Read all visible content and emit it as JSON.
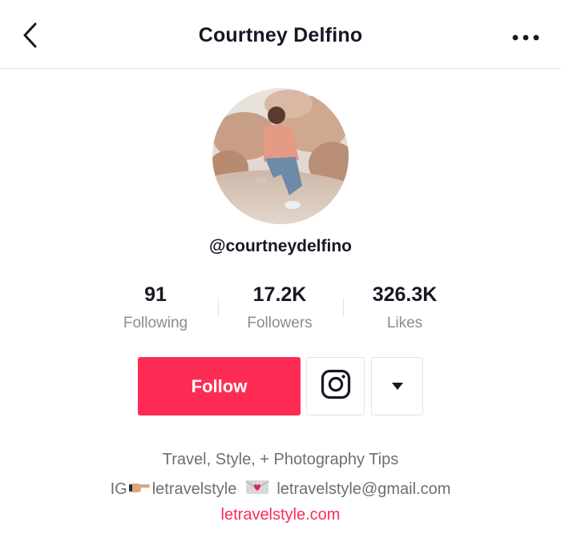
{
  "header": {
    "title": "Courtney Delfino",
    "back_icon": "back-arrow-icon",
    "more_icon": "more-dots-icon"
  },
  "profile": {
    "username": "@courtneydelfino"
  },
  "stats": [
    {
      "value": "91",
      "label": "Following"
    },
    {
      "value": "17.2K",
      "label": "Followers"
    },
    {
      "value": "326.3K",
      "label": "Likes"
    }
  ],
  "actions": {
    "follow_label": "Follow",
    "instagram_icon": "instagram-icon",
    "dropdown_icon": "caret-down-icon"
  },
  "bio": {
    "line1": "Travel, Style, + Photography Tips",
    "line2_prefix": "IG",
    "line2_handle": "letravelstyle",
    "line2_email": "letravelstyle@gmail.com",
    "link": "letravelstyle.com"
  },
  "colors": {
    "accent": "#fe2c55",
    "text": "#161823",
    "muted": "#8a8b91",
    "border": "#e3e3e4"
  }
}
